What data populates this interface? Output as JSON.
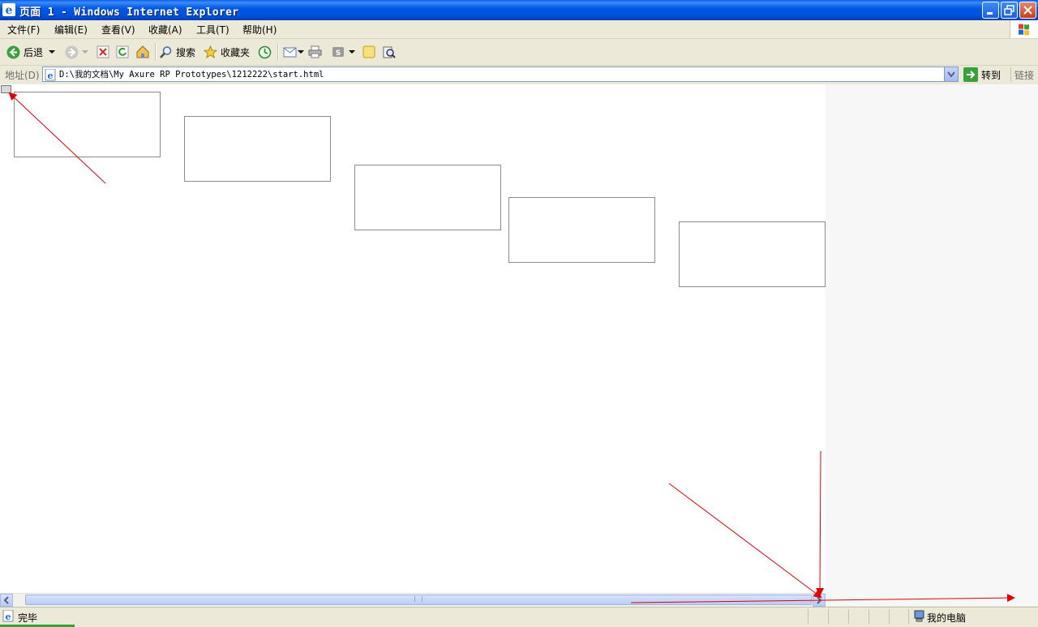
{
  "window": {
    "title": "页面 1 - Windows Internet Explorer"
  },
  "menu": {
    "items": [
      "文件(F)",
      "编辑(E)",
      "查看(V)",
      "收藏(A)",
      "工具(T)",
      "帮助(H)"
    ]
  },
  "toolbar": {
    "back_label": "后退",
    "search_label": "搜索",
    "favorites_label": "收藏夹"
  },
  "address": {
    "label": "地址(D)",
    "url": "D:\\我的文档\\My Axure RP Prototypes\\1212222\\start.html",
    "go_label": "转到",
    "links_label": "链接"
  },
  "status": {
    "text": "完毕",
    "zone": "我的电脑"
  },
  "colors": {
    "annotation_arrow": "#E00000",
    "title_bar": "#0055E5"
  },
  "icons": [
    "ie-icon",
    "minimize-icon",
    "restore-icon",
    "close-icon",
    "windows-logo-icon",
    "back-icon",
    "forward-icon",
    "stop-icon",
    "refresh-icon",
    "home-icon",
    "search-icon",
    "favorites-star-icon",
    "history-icon",
    "mail-icon",
    "print-icon",
    "edit-icon",
    "discuss-icon",
    "research-icon",
    "page-icon",
    "go-arrow-icon",
    "computer-zone-icon"
  ]
}
